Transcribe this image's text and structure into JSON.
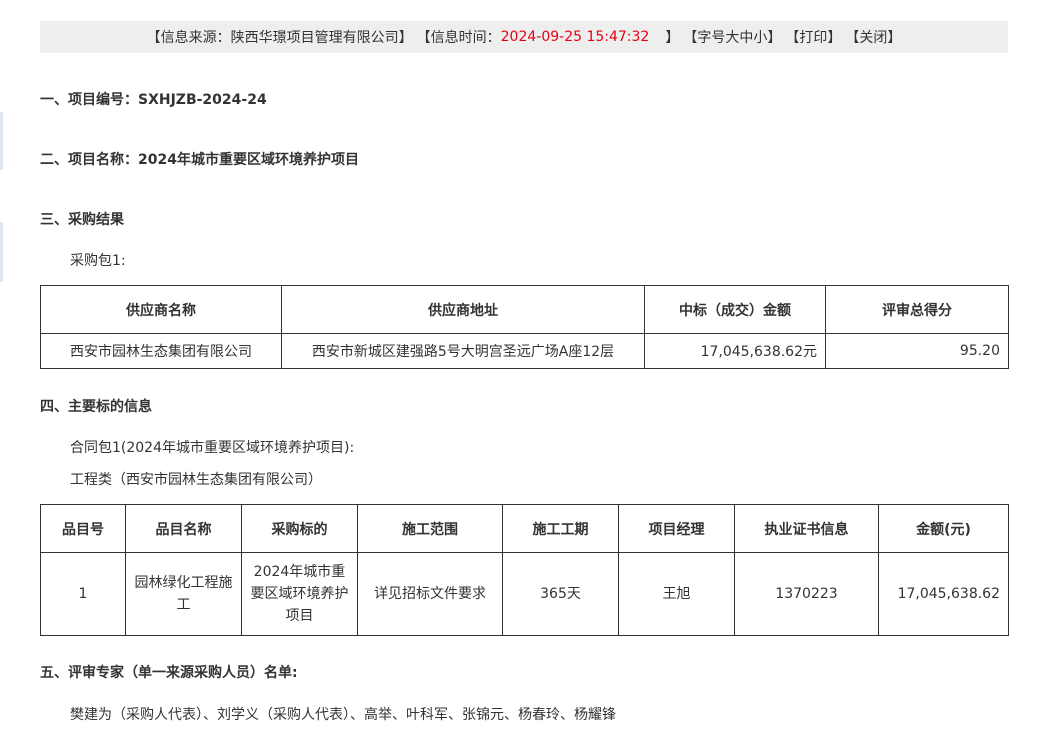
{
  "info_bar": {
    "source": "【信息来源：陕西华璟项目管理有限公司】",
    "time_prefix": "【信息时间：",
    "time_value": "2024-09-25 15:47:32",
    "time_suffix": "】",
    "font_size_label": "【字号",
    "font_large": "大",
    "font_medium": "中",
    "font_small": "小】",
    "print": "【打印】",
    "close": "【关闭】"
  },
  "sections": {
    "project_number": "一、项目编号：SXHJZB-2024-24",
    "project_name": "二、项目名称：2024年城市重要区域环境养护项目",
    "procurement_result": "三、采购结果",
    "package_label": "采购包1:",
    "main_subject": "四、主要标的信息",
    "contract_package": "合同包1(2024年城市重要区域环境养护项目):",
    "engineering_type": "工程类（西安市园林生态集团有限公司）",
    "experts": "五、评审专家（单一来源采购人员）名单:",
    "expert_list": "樊建为（采购人代表）、刘学义（采购人代表）、高举、叶科军、张锦元、杨春玲、杨耀锋"
  },
  "result_table": {
    "headers": [
      "供应商名称",
      "供应商地址",
      "中标（成交）金额",
      "评审总得分"
    ],
    "rows": [
      [
        "西安市园林生态集团有限公司",
        "西安市新城区建强路5号大明宫圣远广场A座12层",
        "17,045,638.62元",
        "95.20"
      ]
    ]
  },
  "subject_table": {
    "headers": [
      "品目号",
      "品目名称",
      "采购标的",
      "施工范围",
      "施工工期",
      "项目经理",
      "执业证书信息",
      "金额(元)"
    ],
    "rows": [
      [
        "1",
        "园林绿化工程施工",
        "2024年城市重要区域环境养护项目",
        "详见招标文件要求",
        "365天",
        "王旭",
        "1370223",
        "17,045,638.62"
      ]
    ]
  }
}
